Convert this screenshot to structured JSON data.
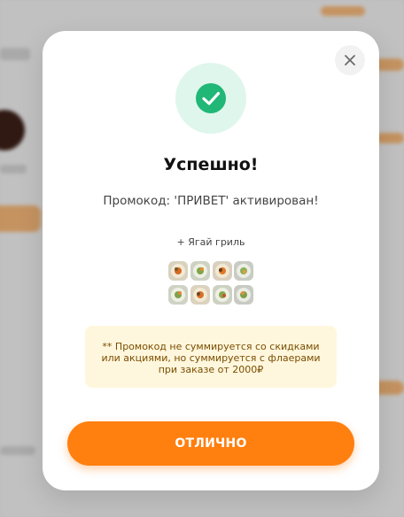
{
  "modal": {
    "title": "Успешно!",
    "message": "Промокод: 'ПРИВЕТ' активирован!",
    "bonus": "+ Ягай гриль",
    "notice": "** Промокод не суммируется со скидками или акциями, но суммируется с флаерами при заказе от 2000₽",
    "ok_button_label": "ОТЛИЧНО"
  },
  "colors": {
    "accent": "#ff7f0f",
    "success": "#20b777",
    "notice_bg": "#fff7dd"
  },
  "icons": {
    "close": "close-icon",
    "success": "check-icon"
  }
}
